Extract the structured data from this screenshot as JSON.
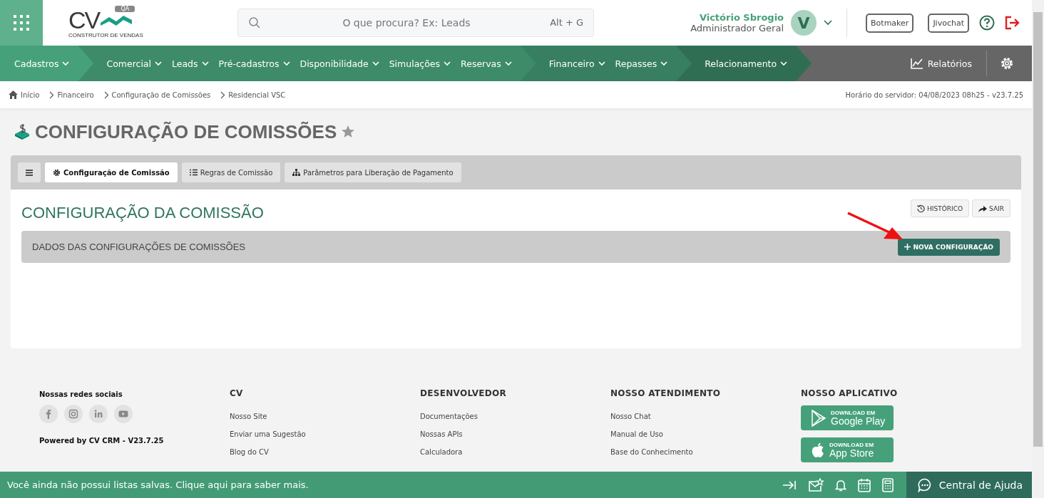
{
  "header": {
    "logo": {
      "letters": "CV",
      "badge": "QA",
      "tagline": "CONSTRUTOR DE VENDAS"
    },
    "search": {
      "placeholder": "O que procura? Ex: Leads",
      "shortcut": "Alt + G"
    },
    "user": {
      "name": "Victório Sbrogio",
      "role": "Administrador Geral",
      "initial": "V"
    },
    "buttons": [
      "Botmaker",
      "Jivochat"
    ]
  },
  "nav": {
    "groups": [
      {
        "color": "#46a17b",
        "items": [
          "Cadastros"
        ]
      },
      {
        "color": "#3d8b69",
        "items": [
          "Comercial",
          "Leads",
          "Pré-cadastros",
          "Disponibilidade",
          "Simulações",
          "Reservas"
        ]
      },
      {
        "color": "#377f60",
        "items": [
          "Financeiro",
          "Repasses"
        ]
      },
      {
        "color": "#2f6e53",
        "items": [
          "Relacionamento"
        ]
      }
    ],
    "reports": "Relatórios"
  },
  "breadcrumb": [
    "Início",
    "Financeiro",
    "Configuração de Comissões",
    "Residencial VSC"
  ],
  "server_time": "Horário do servidor: 04/08/2023 08h25 - v23.7.25",
  "page_title": "CONFIGURAÇÃO DE COMISSÕES",
  "tabs": [
    {
      "label": "Configuração de Comissão",
      "selected": true
    },
    {
      "label": "Regras de Comissão",
      "selected": false
    },
    {
      "label": "Parâmetros para Liberação de Pagamento",
      "selected": false
    }
  ],
  "section": {
    "title": "CONFIGURAÇÃO DA COMISSÃO",
    "actions": [
      "HISTÓRICO",
      "SAIR"
    ],
    "panel_title": "DADOS DAS CONFIGURAÇÕES DE COMISSÕES",
    "primary_button": "NOVA CONFIGURAÇÃO"
  },
  "annotation": {
    "kind": "arrow"
  },
  "footer": {
    "social_title": "Nossas redes sociais",
    "powered": "Powered by CV CRM - V23.7.25",
    "columns": [
      {
        "title": "CV",
        "links": [
          "Nosso Site",
          "Enviar uma Sugestão",
          "Blog do CV"
        ]
      },
      {
        "title": "DESENVOLVEDOR",
        "links": [
          "Documentações",
          "Nossas APIs",
          "Calculadora"
        ]
      },
      {
        "title": "NOSSO ATENDIMENTO",
        "links": [
          "Nosso Chat",
          "Manual de Uso",
          "Base do Conhecimento"
        ]
      }
    ],
    "app_title": "NOSSO APLICATIVO",
    "stores": [
      {
        "kind": "google",
        "small": "DOWNLOAD EM",
        "big": "Google Play"
      },
      {
        "kind": "apple",
        "small": "DOWNLOAD EM",
        "big": "App Store"
      }
    ]
  },
  "bottom_bar": {
    "message": "Você ainda não possui listas salvas. Clique aqui para saber mais.",
    "help": "Central de Ajuda"
  }
}
